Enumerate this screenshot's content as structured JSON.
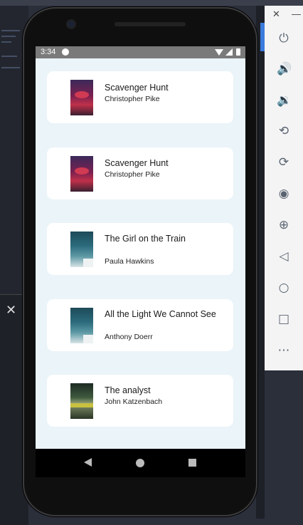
{
  "status": {
    "time": "3:34"
  },
  "books": [
    {
      "title": "Scavenger Hunt",
      "author": "Christopher Pike",
      "cover": "horror"
    },
    {
      "title": "Scavenger Hunt",
      "author": "Christopher Pike",
      "cover": "horror"
    },
    {
      "title": "The Girl on the Train",
      "author": "Paula Hawkins",
      "cover": "ocean"
    },
    {
      "title": "All the Light We Cannot See",
      "author": "Anthony Doerr",
      "cover": "ocean"
    },
    {
      "title": "The analyst",
      "author": "John Katzenbach",
      "cover": "eye"
    }
  ],
  "toolbar": {
    "close": "✕",
    "minimize": "—",
    "icons": [
      "power-icon",
      "volume-up-icon",
      "volume-down-icon",
      "rotate-left-icon",
      "rotate-right-icon",
      "camera-icon",
      "zoom-icon",
      "back-icon",
      "home-icon",
      "overview-icon",
      "more-icon"
    ]
  },
  "colors": {
    "screen_bg": "#eaf4f9",
    "card_bg": "#ffffff",
    "statusbar": "#7a7a7a"
  }
}
